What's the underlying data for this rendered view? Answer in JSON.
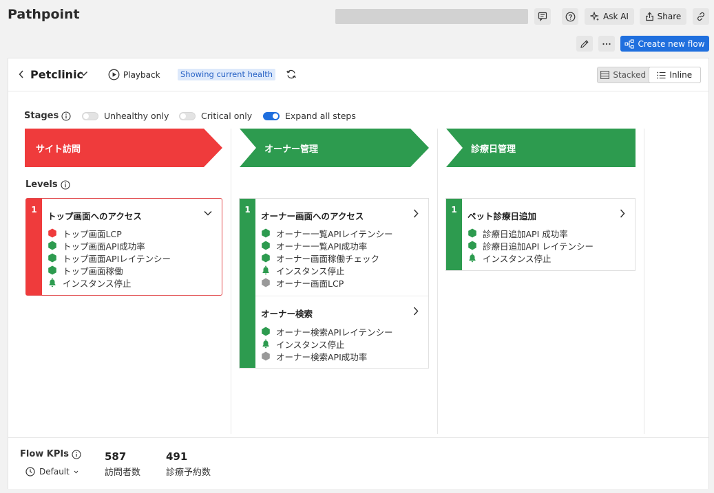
{
  "app_title": "Pathpoint",
  "toolbar": {
    "ask_ai": "Ask AI",
    "share": "Share",
    "create_flow": "Create new flow"
  },
  "flow": {
    "name": "Petclinic",
    "playback": "Playback",
    "health_tag": "Showing current health",
    "view_stacked": "Stacked",
    "view_inline": "Inline",
    "view_selected": "Inline"
  },
  "controls": {
    "stages_label": "Stages",
    "unhealthy_only": "Unhealthy only",
    "unhealthy_only_on": false,
    "critical_only": "Critical only",
    "critical_only_on": false,
    "expand_all": "Expand all steps",
    "expand_all_on": true,
    "levels_label": "Levels"
  },
  "colors": {
    "critical": "#ef3b3c",
    "healthy": "#2d9b4f",
    "unknown": "#999999",
    "accent": "#1f6fde"
  },
  "stages": [
    {
      "name": "サイト訪問",
      "status": "critical",
      "levels": [
        {
          "number": "1",
          "status": "critical",
          "steps": [
            {
              "title": "トップ画面へのアクセス",
              "expanded": true,
              "signals": [
                {
                  "icon": "hexagon-icon",
                  "status": "critical",
                  "label": "トップ画面LCP"
                },
                {
                  "icon": "hexagon-icon",
                  "status": "healthy",
                  "label": "トップ画面API成功率"
                },
                {
                  "icon": "hexagon-icon",
                  "status": "healthy",
                  "label": "トップ画面APIレイテンシー"
                },
                {
                  "icon": "hexagon-icon",
                  "status": "healthy",
                  "label": "トップ画面稼働"
                },
                {
                  "icon": "bell-icon",
                  "status": "healthy",
                  "label": "インスタンス停止"
                }
              ]
            }
          ]
        }
      ]
    },
    {
      "name": "オーナー管理",
      "status": "healthy",
      "levels": [
        {
          "number": "1",
          "status": "healthy",
          "steps": [
            {
              "title": "オーナー画面へのアクセス",
              "expanded": false,
              "signals": [
                {
                  "icon": "hexagon-icon",
                  "status": "healthy",
                  "label": "オーナー一覧APIレイテンシー"
                },
                {
                  "icon": "hexagon-icon",
                  "status": "healthy",
                  "label": "オーナー一覧API成功率"
                },
                {
                  "icon": "hexagon-icon",
                  "status": "healthy",
                  "label": "オーナー画面稼働チェック"
                },
                {
                  "icon": "bell-icon",
                  "status": "healthy",
                  "label": "インスタンス停止"
                },
                {
                  "icon": "hexagon-icon",
                  "status": "unknown",
                  "label": "オーナー画面LCP"
                }
              ]
            },
            {
              "title": "オーナー検索",
              "expanded": false,
              "signals": [
                {
                  "icon": "hexagon-icon",
                  "status": "healthy",
                  "label": "オーナー検索APIレイテンシー"
                },
                {
                  "icon": "bell-icon",
                  "status": "healthy",
                  "label": "インスタンス停止"
                },
                {
                  "icon": "hexagon-icon",
                  "status": "unknown",
                  "label": "オーナー検索API成功率"
                }
              ]
            }
          ]
        }
      ]
    },
    {
      "name": "診療日管理",
      "status": "healthy",
      "levels": [
        {
          "number": "1",
          "status": "healthy",
          "steps": [
            {
              "title": "ペット診療日追加",
              "expanded": false,
              "signals": [
                {
                  "icon": "hexagon-icon",
                  "status": "healthy",
                  "label": "診療日追加API 成功率"
                },
                {
                  "icon": "hexagon-icon",
                  "status": "healthy",
                  "label": "診療日追加API レイテンシー"
                },
                {
                  "icon": "bell-icon",
                  "status": "healthy",
                  "label": "インスタンス停止"
                }
              ]
            }
          ]
        }
      ]
    }
  ],
  "kpis": {
    "title": "Flow KPIs",
    "period": "Default",
    "items": [
      {
        "value": "587",
        "label": "訪問者数"
      },
      {
        "value": "491",
        "label": "診療予約数"
      }
    ]
  }
}
